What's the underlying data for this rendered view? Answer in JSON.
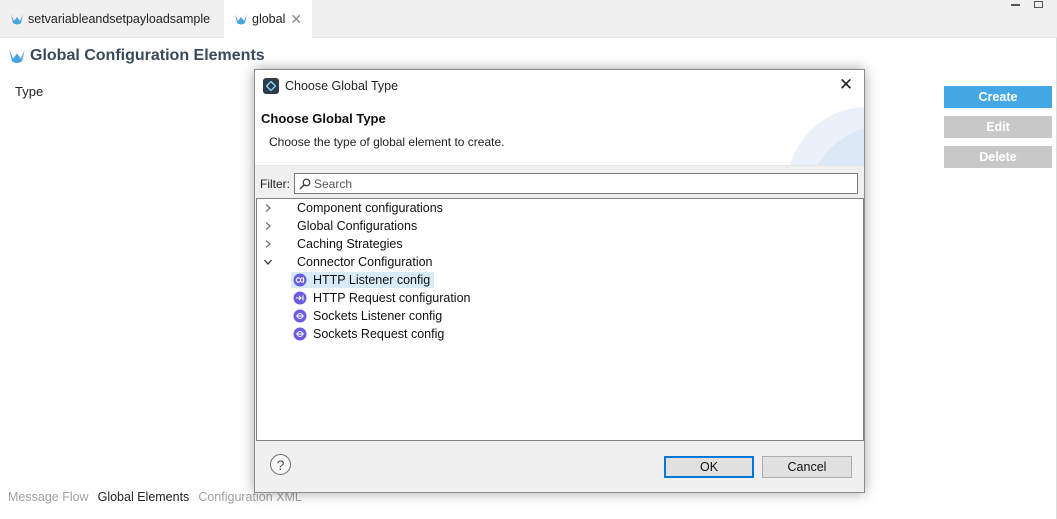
{
  "editor": {
    "tabs": [
      {
        "label": "setvariableandsetpayloadsample",
        "active": false
      },
      {
        "label": "global",
        "active": true,
        "closable": true
      }
    ],
    "page_title": "Global Configuration Elements",
    "column_header": "Type",
    "buttons": {
      "create": "Create",
      "edit": "Edit",
      "delete": "Delete"
    },
    "bottom_tabs": [
      "Message Flow",
      "Global Elements",
      "Configuration XML"
    ],
    "accent_color": "#45a8e6"
  },
  "dialog": {
    "window_title": "Choose Global Type",
    "heading": "Choose Global Type",
    "description": "Choose the type of global element to create.",
    "filter": {
      "label": "Filter:",
      "placeholder": "Search",
      "value": ""
    },
    "tree": {
      "categories": [
        {
          "label": "Component configurations",
          "expanded": false
        },
        {
          "label": "Global Configurations",
          "expanded": false
        },
        {
          "label": "Caching Strategies",
          "expanded": false
        },
        {
          "label": "Connector Configuration",
          "expanded": true
        }
      ],
      "children": [
        {
          "label": "HTTP Listener config",
          "icon": "http-listener-icon",
          "selected": true
        },
        {
          "label": "HTTP Request configuration",
          "icon": "http-request-icon",
          "selected": false
        },
        {
          "label": "Sockets Listener config",
          "icon": "sockets-icon",
          "selected": false
        },
        {
          "label": "Sockets Request config",
          "icon": "sockets-icon",
          "selected": false
        }
      ]
    },
    "help_symbol": "?",
    "ok_label": "OK",
    "cancel_label": "Cancel",
    "selection_color": "#d9ebf9"
  }
}
